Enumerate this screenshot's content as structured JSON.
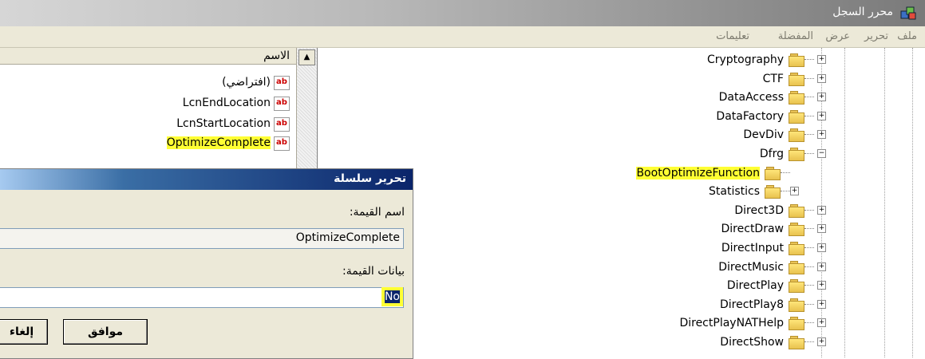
{
  "window": {
    "title": "محرر السجل",
    "icon": "regedit-icon"
  },
  "menu": [
    "ملف",
    "تحرير",
    "عرض",
    "المفضلة",
    "تعليمات"
  ],
  "values_pane": {
    "column_name": "الاسم",
    "rows": [
      {
        "name": "(افتراضي)"
      },
      {
        "name": "LcnEndLocation"
      },
      {
        "name": "LcnStartLocation"
      },
      {
        "name": "OptimizeComplete",
        "highlighted": true
      }
    ],
    "type_icon_text": "ab"
  },
  "tree": {
    "nodes": [
      {
        "label": "Cryptography"
      },
      {
        "label": "CTF"
      },
      {
        "label": "DataAccess"
      },
      {
        "label": "DataFactory"
      },
      {
        "label": "DevDiv"
      },
      {
        "label": "Dfrg",
        "expanded": true
      },
      {
        "label": "BootOptimizeFunction",
        "child": true,
        "highlighted": true
      },
      {
        "label": "Statistics",
        "child": true
      },
      {
        "label": "Direct3D"
      },
      {
        "label": "DirectDraw"
      },
      {
        "label": "DirectInput"
      },
      {
        "label": "DirectMusic"
      },
      {
        "label": "DirectPlay"
      },
      {
        "label": "DirectPlay8"
      },
      {
        "label": "DirectPlayNATHelp"
      },
      {
        "label": "DirectShow"
      }
    ],
    "expand_symbol": "+",
    "collapse_symbol": "−"
  },
  "dialog": {
    "title": "تحرير سلسلة",
    "value_name_label": "اسم القيمة:",
    "value_name": "OptimizeComplete",
    "value_data_label": "بيانات القيمة:",
    "value_data": "No",
    "ok_label": "موافق",
    "cancel_label": "إلغاء"
  },
  "colors": {
    "highlight": "#ffff33",
    "titlebar": "#0a246a",
    "chrome": "#ece9d8"
  }
}
